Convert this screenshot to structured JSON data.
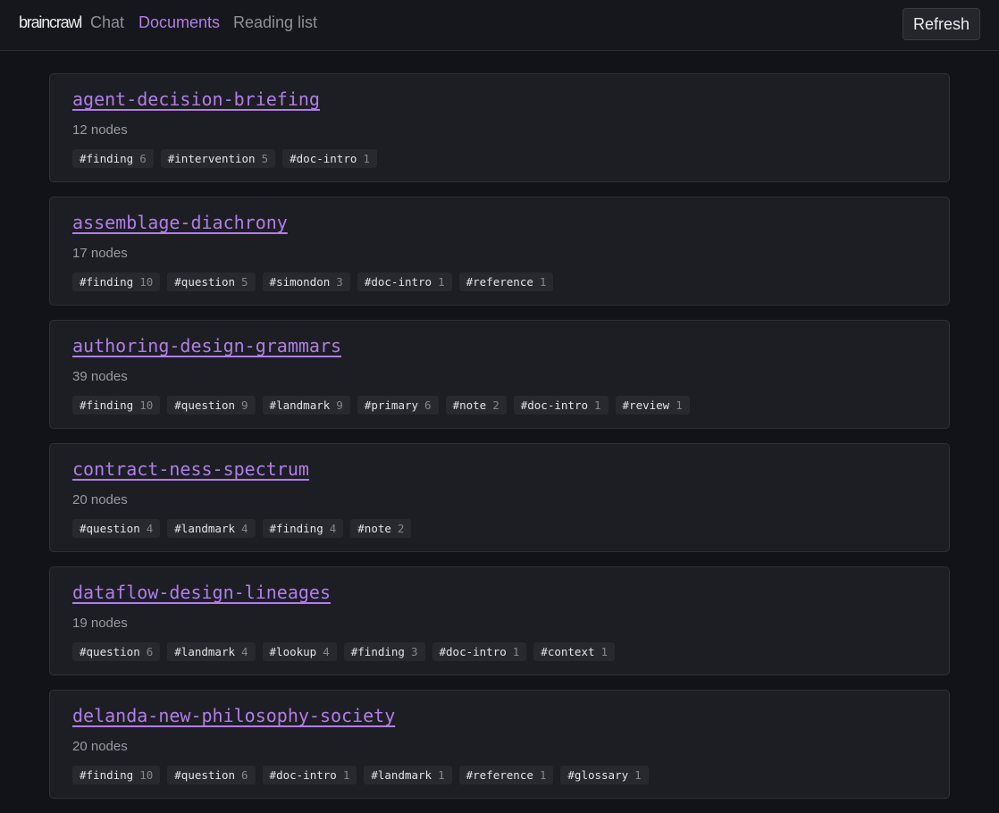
{
  "header": {
    "brand": "braincrawl",
    "nav": [
      {
        "label": "Chat",
        "active": false
      },
      {
        "label": "Documents",
        "active": true
      },
      {
        "label": "Reading list",
        "active": false
      }
    ],
    "refresh_label": "Refresh"
  },
  "colors": {
    "accent": "#b07ee6",
    "background": "#121318",
    "card": "#1d1e24",
    "tag": "#28292f"
  },
  "documents": [
    {
      "title": "agent-decision-briefing",
      "count": "12 nodes",
      "tags": [
        {
          "name": "#finding",
          "count": "6"
        },
        {
          "name": "#intervention",
          "count": "5"
        },
        {
          "name": "#doc-intro",
          "count": "1"
        }
      ]
    },
    {
      "title": "assemblage-diachrony",
      "count": "17 nodes",
      "tags": [
        {
          "name": "#finding",
          "count": "10"
        },
        {
          "name": "#question",
          "count": "5"
        },
        {
          "name": "#simondon",
          "count": "3"
        },
        {
          "name": "#doc-intro",
          "count": "1"
        },
        {
          "name": "#reference",
          "count": "1"
        }
      ]
    },
    {
      "title": "authoring-design-grammars",
      "count": "39 nodes",
      "tags": [
        {
          "name": "#finding",
          "count": "10"
        },
        {
          "name": "#question",
          "count": "9"
        },
        {
          "name": "#landmark",
          "count": "9"
        },
        {
          "name": "#primary",
          "count": "6"
        },
        {
          "name": "#note",
          "count": "2"
        },
        {
          "name": "#doc-intro",
          "count": "1"
        },
        {
          "name": "#review",
          "count": "1"
        }
      ]
    },
    {
      "title": "contract-ness-spectrum",
      "count": "20 nodes",
      "tags": [
        {
          "name": "#question",
          "count": "4"
        },
        {
          "name": "#landmark",
          "count": "4"
        },
        {
          "name": "#finding",
          "count": "4"
        },
        {
          "name": "#note",
          "count": "2"
        }
      ]
    },
    {
      "title": "dataflow-design-lineages",
      "count": "19 nodes",
      "tags": [
        {
          "name": "#question",
          "count": "6"
        },
        {
          "name": "#landmark",
          "count": "4"
        },
        {
          "name": "#lookup",
          "count": "4"
        },
        {
          "name": "#finding",
          "count": "3"
        },
        {
          "name": "#doc-intro",
          "count": "1"
        },
        {
          "name": "#context",
          "count": "1"
        }
      ]
    },
    {
      "title": "delanda-new-philosophy-society",
      "count": "20 nodes",
      "tags": [
        {
          "name": "#finding",
          "count": "10"
        },
        {
          "name": "#question",
          "count": "6"
        },
        {
          "name": "#doc-intro",
          "count": "1"
        },
        {
          "name": "#landmark",
          "count": "1"
        },
        {
          "name": "#reference",
          "count": "1"
        },
        {
          "name": "#glossary",
          "count": "1"
        }
      ]
    }
  ]
}
